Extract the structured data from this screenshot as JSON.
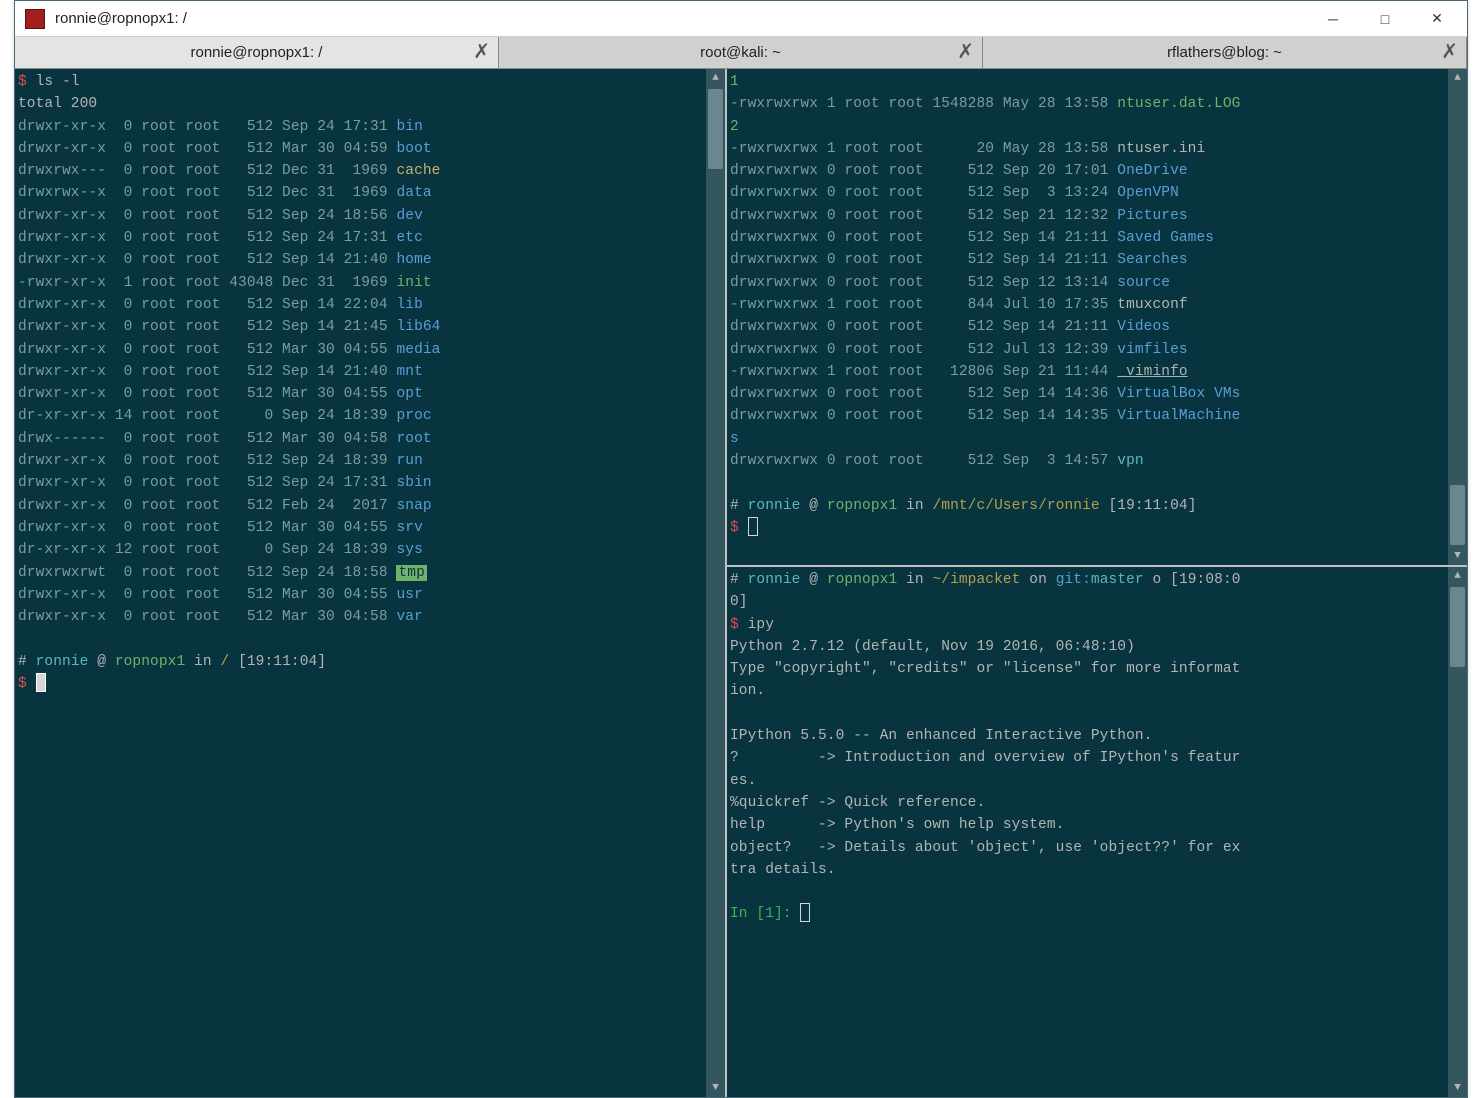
{
  "window": {
    "title": "ronnie@ropnopx1: /"
  },
  "tabs": [
    {
      "label": "ronnie@ropnopx1: /"
    },
    {
      "label": "root@kali: ~"
    },
    {
      "label": "rflathers@blog: ~"
    }
  ],
  "colors": {
    "bg": "#08343f",
    "fg": "#b4b4b4",
    "prompt": "#d94f4f",
    "dir": "#5a9ed6",
    "green": "#6fb26a",
    "yellow": "#c9b26a",
    "cyan": "#5fb8b8"
  },
  "left": {
    "cmd": "ls -l",
    "total": "total 200",
    "rows": [
      {
        "perm": "drwxr-xr-x",
        "n": " 0",
        "own": "root root",
        "size": "  512",
        "date": "Sep 24 17:31",
        "name": "bin",
        "cls": "c-dir"
      },
      {
        "perm": "drwxr-xr-x",
        "n": " 0",
        "own": "root root",
        "size": "  512",
        "date": "Mar 30 04:59",
        "name": "boot",
        "cls": "c-dir"
      },
      {
        "perm": "drwxrwx---",
        "n": " 0",
        "own": "root root",
        "size": "  512",
        "date": "Dec 31  1969",
        "name": "cache",
        "cls": "c-yellow"
      },
      {
        "perm": "drwxrwx--x",
        "n": " 0",
        "own": "root root",
        "size": "  512",
        "date": "Dec 31  1969",
        "name": "data",
        "cls": "c-dir"
      },
      {
        "perm": "drwxr-xr-x",
        "n": " 0",
        "own": "root root",
        "size": "  512",
        "date": "Sep 24 18:56",
        "name": "dev",
        "cls": "c-dir"
      },
      {
        "perm": "drwxr-xr-x",
        "n": " 0",
        "own": "root root",
        "size": "  512",
        "date": "Sep 24 17:31",
        "name": "etc",
        "cls": "c-dir"
      },
      {
        "perm": "drwxr-xr-x",
        "n": " 0",
        "own": "root root",
        "size": "  512",
        "date": "Sep 14 21:40",
        "name": "home",
        "cls": "c-dir"
      },
      {
        "perm": "-rwxr-xr-x",
        "n": " 1",
        "own": "root root",
        "size": "43048",
        "date": "Dec 31  1969",
        "name": "init",
        "cls": "c-green"
      },
      {
        "perm": "drwxr-xr-x",
        "n": " 0",
        "own": "root root",
        "size": "  512",
        "date": "Sep 14 22:04",
        "name": "lib",
        "cls": "c-dir"
      },
      {
        "perm": "drwxr-xr-x",
        "n": " 0",
        "own": "root root",
        "size": "  512",
        "date": "Sep 14 21:45",
        "name": "lib64",
        "cls": "c-dir"
      },
      {
        "perm": "drwxr-xr-x",
        "n": " 0",
        "own": "root root",
        "size": "  512",
        "date": "Mar 30 04:55",
        "name": "media",
        "cls": "c-dir"
      },
      {
        "perm": "drwxr-xr-x",
        "n": " 0",
        "own": "root root",
        "size": "  512",
        "date": "Sep 14 21:40",
        "name": "mnt",
        "cls": "c-dir"
      },
      {
        "perm": "drwxr-xr-x",
        "n": " 0",
        "own": "root root",
        "size": "  512",
        "date": "Mar 30 04:55",
        "name": "opt",
        "cls": "c-dir"
      },
      {
        "perm": "dr-xr-xr-x",
        "n": "14",
        "own": "root root",
        "size": "    0",
        "date": "Sep 24 18:39",
        "name": "proc",
        "cls": "c-dir"
      },
      {
        "perm": "drwx------",
        "n": " 0",
        "own": "root root",
        "size": "  512",
        "date": "Mar 30 04:58",
        "name": "root",
        "cls": "c-dir"
      },
      {
        "perm": "drwxr-xr-x",
        "n": " 0",
        "own": "root root",
        "size": "  512",
        "date": "Sep 24 18:39",
        "name": "run",
        "cls": "c-dir"
      },
      {
        "perm": "drwxr-xr-x",
        "n": " 0",
        "own": "root root",
        "size": "  512",
        "date": "Sep 24 17:31",
        "name": "sbin",
        "cls": "c-dir"
      },
      {
        "perm": "drwxr-xr-x",
        "n": " 0",
        "own": "root root",
        "size": "  512",
        "date": "Feb 24  2017",
        "name": "snap",
        "cls": "c-dir"
      },
      {
        "perm": "drwxr-xr-x",
        "n": " 0",
        "own": "root root",
        "size": "  512",
        "date": "Mar 30 04:55",
        "name": "srv",
        "cls": "c-dir"
      },
      {
        "perm": "dr-xr-xr-x",
        "n": "12",
        "own": "root root",
        "size": "    0",
        "date": "Sep 24 18:39",
        "name": "sys",
        "cls": "c-dir"
      },
      {
        "perm": "drwxrwxrwt",
        "n": " 0",
        "own": "root root",
        "size": "  512",
        "date": "Sep 24 18:58",
        "name": "tmp",
        "cls": "c-tmp"
      },
      {
        "perm": "drwxr-xr-x",
        "n": " 0",
        "own": "root root",
        "size": "  512",
        "date": "Mar 30 04:55",
        "name": "usr",
        "cls": "c-dir"
      },
      {
        "perm": "drwxr-xr-x",
        "n": " 0",
        "own": "root root",
        "size": "  512",
        "date": "Mar 30 04:58",
        "name": "var",
        "cls": "c-dir"
      }
    ],
    "prompt_hash": "#",
    "prompt_user": "ronnie",
    "prompt_at": "@",
    "prompt_host": "ropnopx1",
    "prompt_in": "in",
    "prompt_path": "/",
    "prompt_time": "[19:11:04]",
    "prompt_dollar": "$"
  },
  "top": {
    "line1_name": "1",
    "rows": [
      {
        "perm": "-rwxrwxrwx",
        "n": "1",
        "own": "root root",
        "size": "1548288",
        "date": "May 28 13:58",
        "name": "ntuser.dat.LOG",
        "cls": "c-green",
        "wrap": "2"
      },
      {
        "perm": "-rwxrwxrwx",
        "n": "1",
        "own": "root root",
        "size": "     20",
        "date": "May 28 13:58",
        "name": "ntuser.ini",
        "cls": "c-cmd"
      },
      {
        "perm": "drwxrwxrwx",
        "n": "0",
        "own": "root root",
        "size": "    512",
        "date": "Sep 20 17:01",
        "name": "OneDrive",
        "cls": "c-dir"
      },
      {
        "perm": "drwxrwxrwx",
        "n": "0",
        "own": "root root",
        "size": "    512",
        "date": "Sep  3 13:24",
        "name": "OpenVPN",
        "cls": "c-dir"
      },
      {
        "perm": "drwxrwxrwx",
        "n": "0",
        "own": "root root",
        "size": "    512",
        "date": "Sep 21 12:32",
        "name": "Pictures",
        "cls": "c-dir"
      },
      {
        "perm": "drwxrwxrwx",
        "n": "0",
        "own": "root root",
        "size": "    512",
        "date": "Sep 14 21:11",
        "name": "Saved Games",
        "cls": "c-dir"
      },
      {
        "perm": "drwxrwxrwx",
        "n": "0",
        "own": "root root",
        "size": "    512",
        "date": "Sep 14 21:11",
        "name": "Searches",
        "cls": "c-dir"
      },
      {
        "perm": "drwxrwxrwx",
        "n": "0",
        "own": "root root",
        "size": "    512",
        "date": "Sep 12 13:14",
        "name": "source",
        "cls": "c-dir"
      },
      {
        "perm": "-rwxrwxrwx",
        "n": "1",
        "own": "root root",
        "size": "    844",
        "date": "Jul 10 17:35",
        "name": "tmuxconf",
        "cls": "c-cmd"
      },
      {
        "perm": "drwxrwxrwx",
        "n": "0",
        "own": "root root",
        "size": "    512",
        "date": "Sep 14 21:11",
        "name": "Videos",
        "cls": "c-dir"
      },
      {
        "perm": "drwxrwxrwx",
        "n": "0",
        "own": "root root",
        "size": "    512",
        "date": "Jul 13 12:39",
        "name": "vimfiles",
        "cls": "c-dir"
      },
      {
        "perm": "-rwxrwxrwx",
        "n": "1",
        "own": "root root",
        "size": "  12806",
        "date": "Sep 21 11:44",
        "name": "_viminfo",
        "cls": "c-viminfo"
      },
      {
        "perm": "drwxrwxrwx",
        "n": "0",
        "own": "root root",
        "size": "    512",
        "date": "Sep 14 14:36",
        "name": "VirtualBox VMs",
        "cls": "c-dir"
      },
      {
        "perm": "drwxrwxrwx",
        "n": "0",
        "own": "root root",
        "size": "    512",
        "date": "Sep 14 14:35",
        "name": "VirtualMachine",
        "cls": "c-dir",
        "wrap": "s"
      },
      {
        "perm": "drwxrwxrwx",
        "n": "0",
        "own": "root root",
        "size": "    512",
        "date": "Sep  3 14:57",
        "name": "vpn",
        "cls": "c-cyan"
      }
    ],
    "prompt_user": "ronnie",
    "prompt_host": "ropnopx1",
    "prompt_path": "/mnt/c/Users/ronnie",
    "prompt_time": "[19:11:04]",
    "prompt_dollar": "$"
  },
  "bottom": {
    "prompt1_user": "ronnie",
    "prompt1_host": "ropnopx1",
    "prompt1_path": "~/impacket",
    "prompt1_on": "on",
    "prompt1_git": "git:",
    "prompt1_branch": "master",
    "prompt1_o": "o",
    "prompt1_time": "[19:08:0",
    "prompt1_wrap": "0]",
    "cmd": "ipy",
    "l1": "Python 2.7.12 (default, Nov 19 2016, 06:48:10)",
    "l2": "Type \"copyright\", \"credits\" or \"license\" for more informat",
    "l2w": "ion.",
    "l3": "IPython 5.5.0 -- An enhanced Interactive Python.",
    "l4": "?         -> Introduction and overview of IPython's featur",
    "l4w": "es.",
    "l5": "%quickref -> Quick reference.",
    "l6": "help      -> Python's own help system.",
    "l7": "object?   -> Details about 'object', use 'object??' for ex",
    "l7w": "tra details.",
    "ipy_prompt": "In [1]: "
  }
}
